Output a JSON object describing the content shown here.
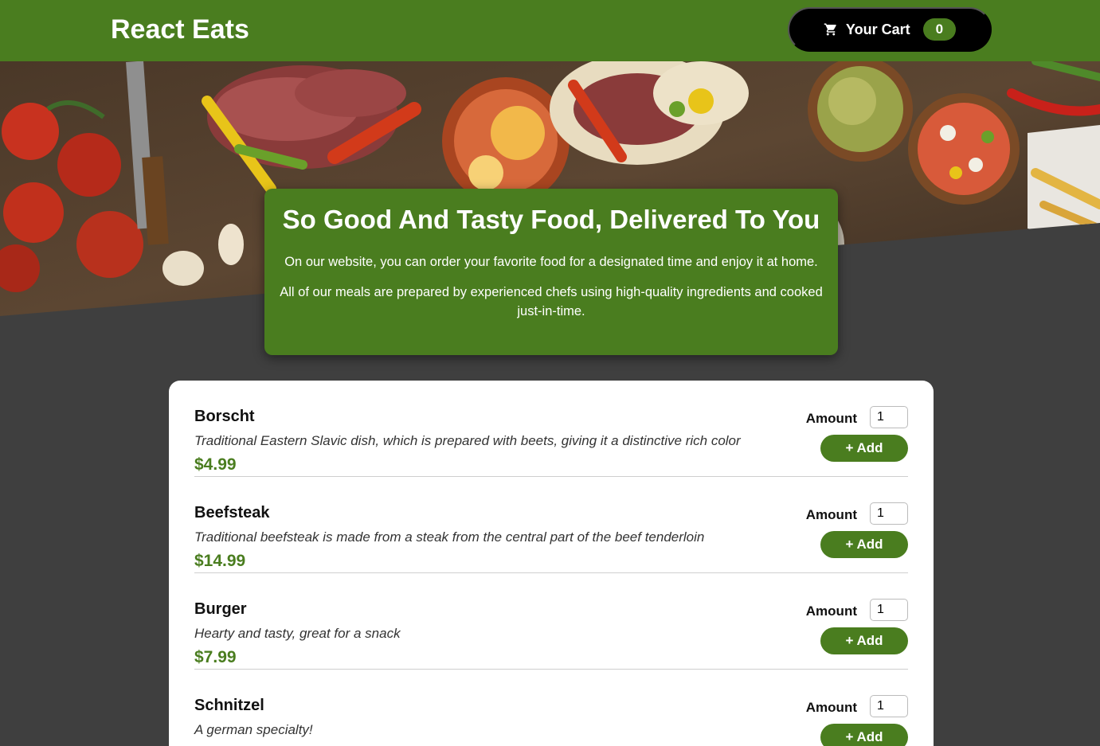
{
  "header": {
    "brand": "React Eats",
    "cart_label": "Your Cart",
    "cart_count": "0"
  },
  "summary": {
    "title": "So Good And Tasty Food, Delivered To You",
    "paragraph1": "On our website, you can order your favorite food for a designated time and enjoy it at home.",
    "paragraph2": "All of our meals are prepared by experienced chefs using high-quality ingredients and cooked just-in-time."
  },
  "meals": [
    {
      "name": "Borscht",
      "description": "Traditional Eastern Slavic dish, which is prepared with beets, giving it a distinctive rich color",
      "price": "$4.99",
      "amount_label": "Amount",
      "amount_value": "1",
      "add_label": "+ Add"
    },
    {
      "name": "Beefsteak",
      "description": "Traditional beefsteak is made from a steak from the central part of the beef tenderloin",
      "price": "$14.99",
      "amount_label": "Amount",
      "amount_value": "1",
      "add_label": "+ Add"
    },
    {
      "name": "Burger",
      "description": "Hearty and tasty, great for a snack",
      "price": "$7.99",
      "amount_label": "Amount",
      "amount_value": "1",
      "add_label": "+ Add"
    },
    {
      "name": "Schnitzel",
      "description": "A german specialty!",
      "price": "",
      "amount_label": "Amount",
      "amount_value": "1",
      "add_label": "+ Add"
    }
  ],
  "colors": {
    "brand_green": "#4a7d1f",
    "background": "#3f3f3f",
    "cart_button": "#000000"
  },
  "icons": {
    "cart": "cart-icon"
  }
}
